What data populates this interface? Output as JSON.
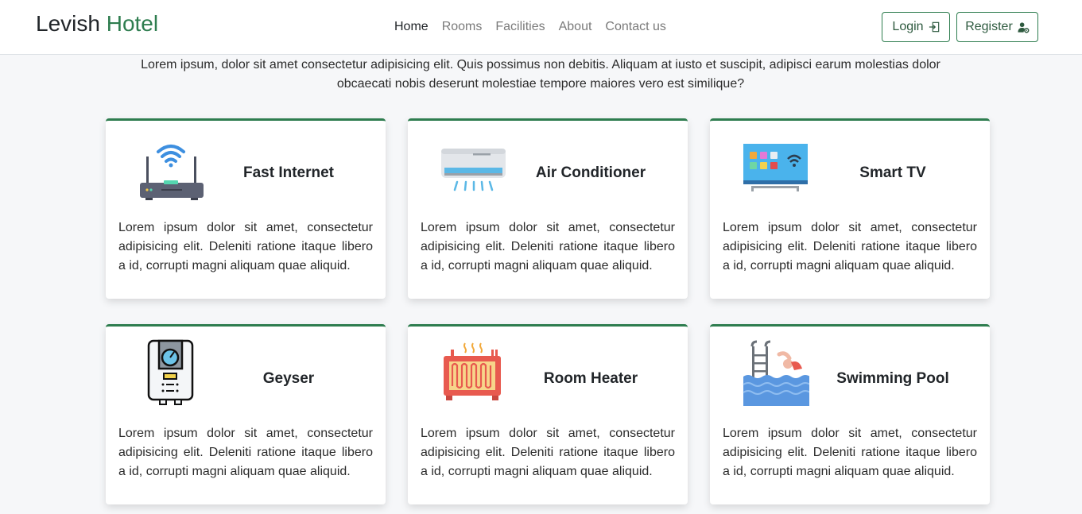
{
  "brand": {
    "name": "Levish",
    "accent": "Hotel",
    "accent_color": "#2e7d4f"
  },
  "nav": {
    "items": [
      "Home",
      "Rooms",
      "Facilities",
      "About",
      "Contact us"
    ],
    "active": "Home"
  },
  "auth": {
    "login_label": "Login",
    "register_label": "Register"
  },
  "intro": "Lorem ipsum, dolor sit amet consectetur adipisicing elit. Quis possimus non debitis. Aliquam at iusto et suscipit, adipisci earum molestias dolor obcaecati nobis deserunt molestiae tempore maiores vero est similique?",
  "facilities": [
    {
      "title": "Fast Internet",
      "icon": "wifi-router-icon",
      "description": "Lorem ipsum dolor sit amet, consectetur adipisicing elit. Deleniti ratione itaque libero a id, corrupti magni aliquam quae aliquid."
    },
    {
      "title": "Air Conditioner",
      "icon": "air-conditioner-icon",
      "description": "Lorem ipsum dolor sit amet, consectetur adipisicing elit. Deleniti ratione itaque libero a id, corrupti magni aliquam quae aliquid."
    },
    {
      "title": "Smart TV",
      "icon": "smart-tv-icon",
      "description": "Lorem ipsum dolor sit amet, consectetur adipisicing elit. Deleniti ratione itaque libero a id, corrupti magni aliquam quae aliquid."
    },
    {
      "title": "Geyser",
      "icon": "geyser-icon",
      "description": "Lorem ipsum dolor sit amet, consectetur adipisicing elit. Deleniti ratione itaque libero a id, corrupti magni aliquam quae aliquid."
    },
    {
      "title": "Room Heater",
      "icon": "room-heater-icon",
      "description": "Lorem ipsum dolor sit amet, consectetur adipisicing elit. Deleniti ratione itaque libero a id, corrupti magni aliquam quae aliquid."
    },
    {
      "title": "Swimming Pool",
      "icon": "swimming-pool-icon",
      "description": "Lorem ipsum dolor sit amet, consectetur adipisicing elit. Deleniti ratione itaque libero a id, corrupti magni aliquam quae aliquid."
    }
  ]
}
